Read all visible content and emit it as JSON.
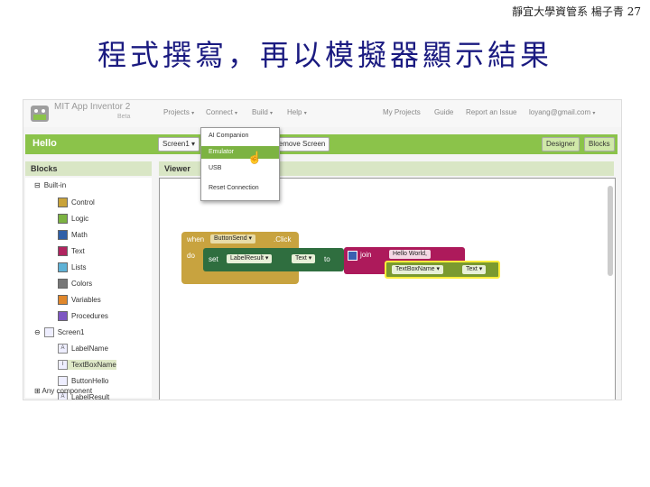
{
  "slide": {
    "header": "靜宜大學資管系 楊子青 27",
    "title": "程式撰寫，再以模擬器顯示結果"
  },
  "app": {
    "brand": "MIT App Inventor 2",
    "brand_sub": "Beta",
    "menus": [
      "Projects",
      "Connect",
      "Build",
      "Help"
    ],
    "right_menus": [
      "My Projects",
      "Guide",
      "Report an Issue",
      "loyang@gmail.com"
    ],
    "project_name": "Hello",
    "screen_select": "Screen1",
    "remove_screen": "Remove Screen",
    "designer_btn": "Designer",
    "blocks_btn": "Blocks",
    "blocks_header": "Blocks",
    "viewer_header": "Viewer",
    "connect_menu": [
      "AI Companion",
      "Emulator",
      "USB",
      "Reset Connection"
    ],
    "selected_menu": "Emulator"
  },
  "tree": {
    "builtin": "Built-in",
    "items": [
      {
        "label": "Control",
        "color": "#c9a33a"
      },
      {
        "label": "Logic",
        "color": "#7cb342"
      },
      {
        "label": "Math",
        "color": "#2f5fa8"
      },
      {
        "label": "Text",
        "color": "#b0245f"
      },
      {
        "label": "Lists",
        "color": "#5fb2d6"
      },
      {
        "label": "Colors",
        "color": "#777777"
      },
      {
        "label": "Variables",
        "color": "#e0872b"
      },
      {
        "label": "Procedures",
        "color": "#7e57c2"
      }
    ],
    "screen": "Screen1",
    "components": [
      "LabelName",
      "TextBoxName",
      "ButtonHello",
      "LabelResult"
    ],
    "any_component": "Any component"
  },
  "code": {
    "when": "when",
    "button": "ButtonSend",
    "event": ".Click",
    "do": "do",
    "set": "set",
    "label_result": "LabelResult",
    "text_prop": "Text",
    "to": "to",
    "join": "join",
    "hello_str": "Hello World,",
    "textbox": "TextBoxName",
    "text_prop2": "Text"
  }
}
